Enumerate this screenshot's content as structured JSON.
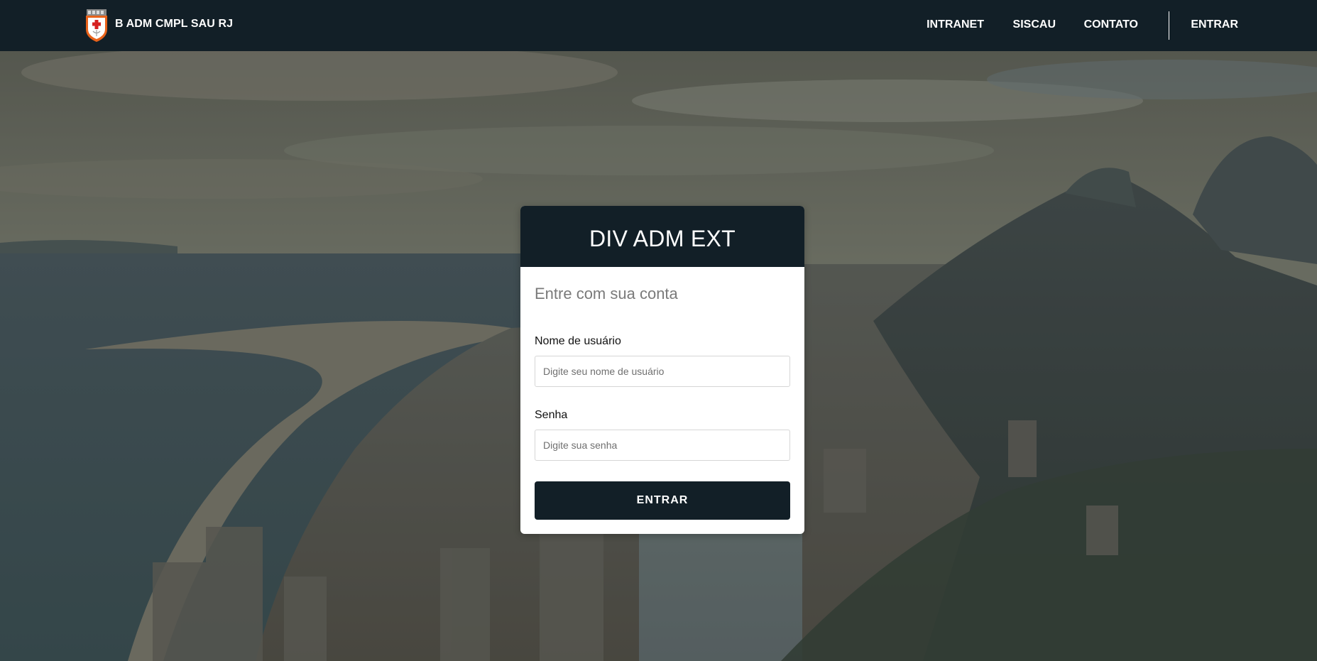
{
  "navbar": {
    "brand": {
      "logo_icon": "military-health-shield-icon",
      "name": "B ADM CMPL SAU RJ"
    },
    "links": [
      {
        "label": "INTRANET"
      },
      {
        "label": "SISCAU"
      },
      {
        "label": "CONTATO"
      },
      {
        "label": "ENTRAR"
      }
    ]
  },
  "background": {
    "description_icon": "rio-de-janeiro-coast-photo"
  },
  "login": {
    "title": "DIV ADM EXT",
    "subtitle": "Entre com sua conta",
    "username": {
      "label": "Nome de usuário",
      "placeholder": "Digite seu nome de usuário",
      "value": ""
    },
    "password": {
      "label": "Senha",
      "placeholder": "Digite sua senha",
      "value": ""
    },
    "submit_label": "ENTRAR"
  },
  "colors": {
    "navbar_bg": "#121f27",
    "card_header_bg": "#121f27",
    "button_bg": "#121f27",
    "text_white": "#ffffff",
    "subtitle_gray": "#7a7a7a"
  }
}
